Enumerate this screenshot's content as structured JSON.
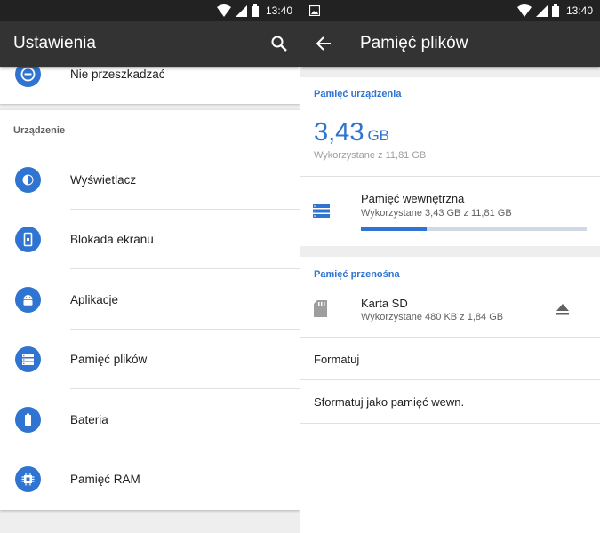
{
  "left": {
    "status_time": "13:40",
    "title": "Ustawienia",
    "partial_item": {
      "label": "Nie przeszkadzać",
      "icon": "minus-circle-icon"
    },
    "section_header": "Urządzenie",
    "items": [
      {
        "label": "Wyświetlacz",
        "icon": "brightness-icon"
      },
      {
        "label": "Blokada ekranu",
        "icon": "phone-lock-icon"
      },
      {
        "label": "Aplikacje",
        "icon": "android-icon"
      },
      {
        "label": "Pamięć plików",
        "icon": "storage-icon"
      },
      {
        "label": "Bateria",
        "icon": "battery-icon"
      },
      {
        "label": "Pamięć RAM",
        "icon": "memory-chip-icon"
      }
    ]
  },
  "right": {
    "status_time": "13:40",
    "title": "Pamięć plików",
    "device_section": {
      "header": "Pamięć urządzenia",
      "used_value": "3,43",
      "used_unit": "GB",
      "used_caption": "Wykorzystane z 11,81 GB"
    },
    "internal": {
      "title": "Pamięć wewnętrzna",
      "subtitle": "Wykorzystane 3,43 GB z 11,81 GB",
      "used_fraction": 0.29
    },
    "portable_section": {
      "header": "Pamięć przenośna",
      "sd_title": "Karta SD",
      "sd_subtitle": "Wykorzystane 480 KB z 1,84 GB"
    },
    "actions": [
      {
        "label": "Formatuj"
      },
      {
        "label": "Sformatuj jako pamięć wewn."
      }
    ]
  },
  "colors": {
    "accent": "#2f74d0",
    "appbar": "#333333",
    "statusbar": "#222222"
  }
}
